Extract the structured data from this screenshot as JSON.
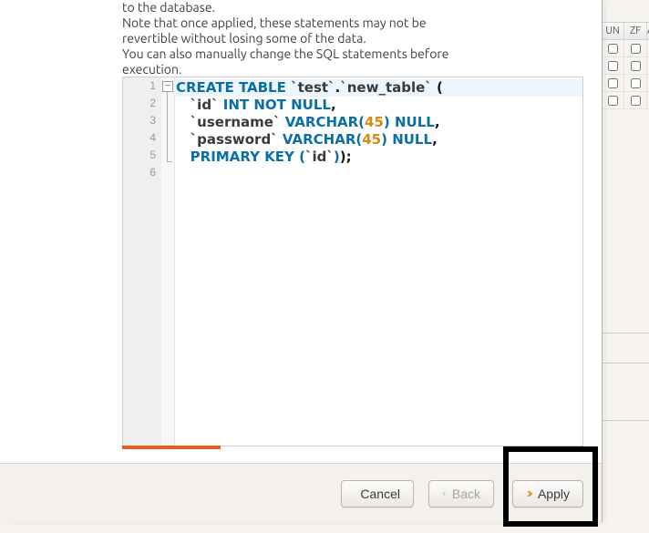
{
  "info": {
    "line0": "to the database.",
    "line1": "Note that once applied, these statements may not be",
    "line2": "revertible without losing some of the data.",
    "line3": "You can also manually change the SQL statements before",
    "line4": "execution."
  },
  "code": {
    "lines": [
      {
        "indent": 0,
        "tokens": [
          {
            "cls": "kw",
            "t": "CREATE TABLE "
          },
          {
            "cls": "ident",
            "t": "`test`"
          },
          {
            "cls": "pun",
            "t": "."
          },
          {
            "cls": "ident",
            "t": "`new_table`"
          },
          {
            "cls": "pun",
            "t": " ("
          }
        ]
      },
      {
        "indent": 1,
        "tokens": [
          {
            "cls": "ident",
            "t": "`id` "
          },
          {
            "cls": "kw",
            "t": "INT NOT NULL"
          },
          {
            "cls": "pun",
            "t": ","
          }
        ]
      },
      {
        "indent": 1,
        "tokens": [
          {
            "cls": "ident",
            "t": "`username` "
          },
          {
            "cls": "kw",
            "t": "VARCHAR("
          },
          {
            "cls": "num",
            "t": "45"
          },
          {
            "cls": "kw",
            "t": ") NULL"
          },
          {
            "cls": "pun",
            "t": ","
          }
        ]
      },
      {
        "indent": 1,
        "tokens": [
          {
            "cls": "ident",
            "t": "`password` "
          },
          {
            "cls": "kw",
            "t": "VARCHAR("
          },
          {
            "cls": "num",
            "t": "45"
          },
          {
            "cls": "kw",
            "t": ") NULL"
          },
          {
            "cls": "pun",
            "t": ","
          }
        ]
      },
      {
        "indent": 1,
        "tokens": [
          {
            "cls": "kw",
            "t": "PRIMARY KEY ("
          },
          {
            "cls": "ident",
            "t": "`id`"
          },
          {
            "cls": "kw",
            "t": ")"
          },
          {
            "cls": "pun",
            "t": ");"
          }
        ]
      },
      {
        "indent": 0,
        "tokens": []
      }
    ]
  },
  "buttons": {
    "cancel": "Cancel",
    "back": "Back",
    "apply": "Apply"
  },
  "grid": {
    "headers": [
      "UN",
      "ZF",
      "A"
    ],
    "rows": 4
  }
}
